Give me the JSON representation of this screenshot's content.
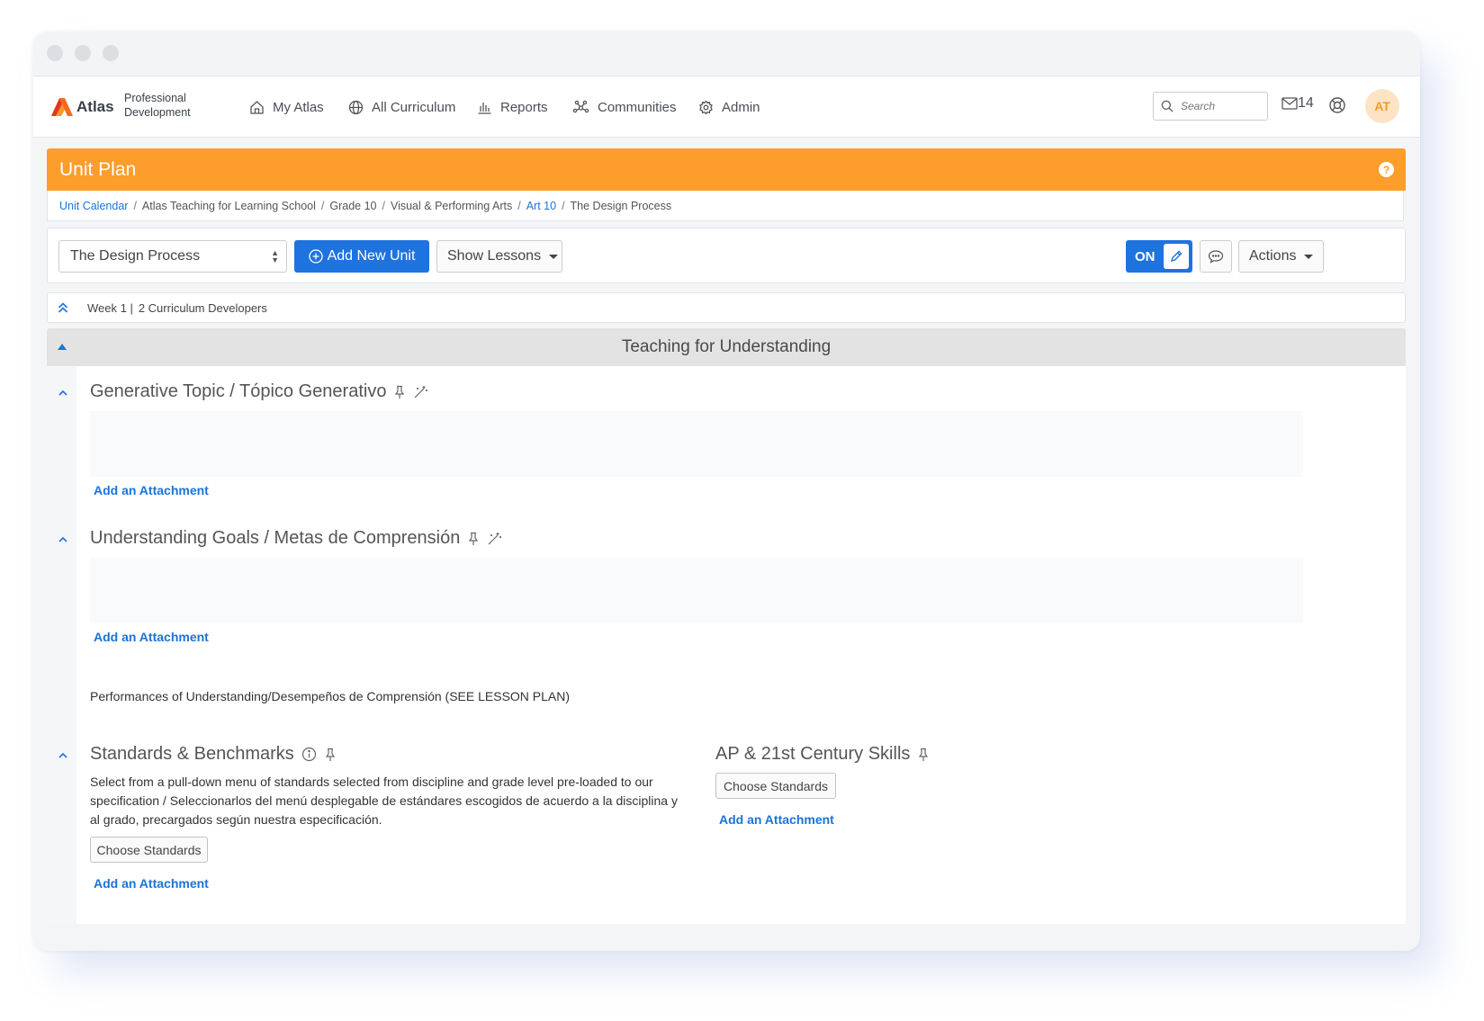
{
  "nav": {
    "brand": "Atlas",
    "product": "Professional Development",
    "items": [
      {
        "label": "My Atlas",
        "icon": "house-icon"
      },
      {
        "label": "All Curriculum",
        "icon": "globe-icon"
      },
      {
        "label": "Reports",
        "icon": "bar-chart-icon"
      },
      {
        "label": "Communities",
        "icon": "network-icon"
      },
      {
        "label": "Admin",
        "icon": "gear-icon"
      }
    ],
    "search_placeholder": "Search",
    "mail_count": "14",
    "avatar_initials": "AT"
  },
  "unit_plan": {
    "title": "Unit Plan",
    "help": "?",
    "breadcrumb": [
      {
        "label": "Unit Calendar",
        "link": true
      },
      {
        "label": "Atlas Teaching for Learning School",
        "link": false
      },
      {
        "label": "Grade 10",
        "link": false
      },
      {
        "label": "Visual & Performing Arts",
        "link": false
      },
      {
        "label": "Art 10",
        "link": true
      },
      {
        "label": "The Design Process",
        "link": false
      }
    ]
  },
  "toolbar": {
    "unit_select": "The Design Process",
    "add_unit": "Add New Unit",
    "show_lessons": "Show Lessons",
    "toggle_label": "ON",
    "actions": "Actions"
  },
  "week": {
    "label": "Week 1 |",
    "developers": "2 Curriculum Developers"
  },
  "section": {
    "title": "Teaching for Understanding"
  },
  "fields": {
    "generative_topic": "Generative Topic / Tópico Generativo",
    "understanding_goals": "Understanding Goals / Metas de Comprensión",
    "performances": "Performances of Understanding/Desempeños de Comprensión (SEE LESSON PLAN)",
    "standards_title": "Standards & Benchmarks",
    "standards_desc": "Select from a pull-down menu of standards selected from discipline and grade level pre-loaded to our specification / Seleccionarlos del menú desplegable de estándares escogidos de acuerdo a la disciplina y al grado, precargados según nuestra especificación.",
    "ap_title": "AP & 21st Century Skills",
    "choose_standards": "Choose Standards",
    "add_attachment": "Add an Attachment"
  },
  "colors": {
    "accent_orange": "#fd9d2b",
    "primary_blue": "#1f73de",
    "link_blue": "#1a73d9"
  }
}
